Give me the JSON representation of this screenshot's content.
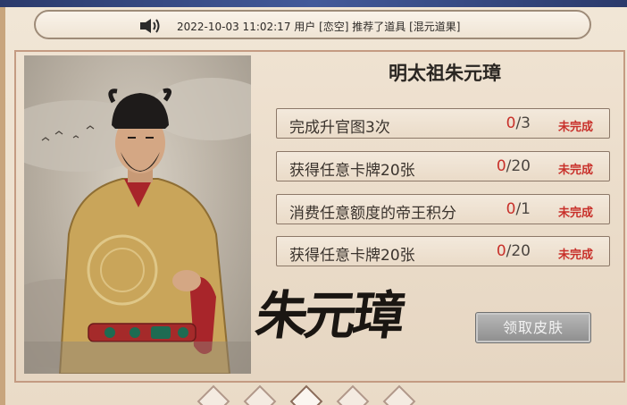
{
  "notice": {
    "icon": "speaker-icon",
    "text": "2022-10-03 11:02:17 用户 [恋空] 推荐了道具 [混元道果]"
  },
  "card": {
    "title": "明太祖朱元璋",
    "calligraphy": "朱元璋",
    "tasks": [
      {
        "label": "完成升官图3次",
        "current": "0",
        "total": "/3",
        "status": "未完成"
      },
      {
        "label": "获得任意卡牌20张",
        "current": "0",
        "total": "/20",
        "status": "未完成"
      },
      {
        "label": "消费任意额度的帝王积分",
        "current": "0",
        "total": "/1",
        "status": "未完成"
      },
      {
        "label": "获得任意卡牌20张",
        "current": "0",
        "total": "/20",
        "status": "未完成"
      }
    ],
    "claim_button": "领取皮肤"
  },
  "colors": {
    "accent_red": "#c8302a",
    "panel_border": "#c49b82",
    "disabled_button": "#9e9e9e"
  }
}
